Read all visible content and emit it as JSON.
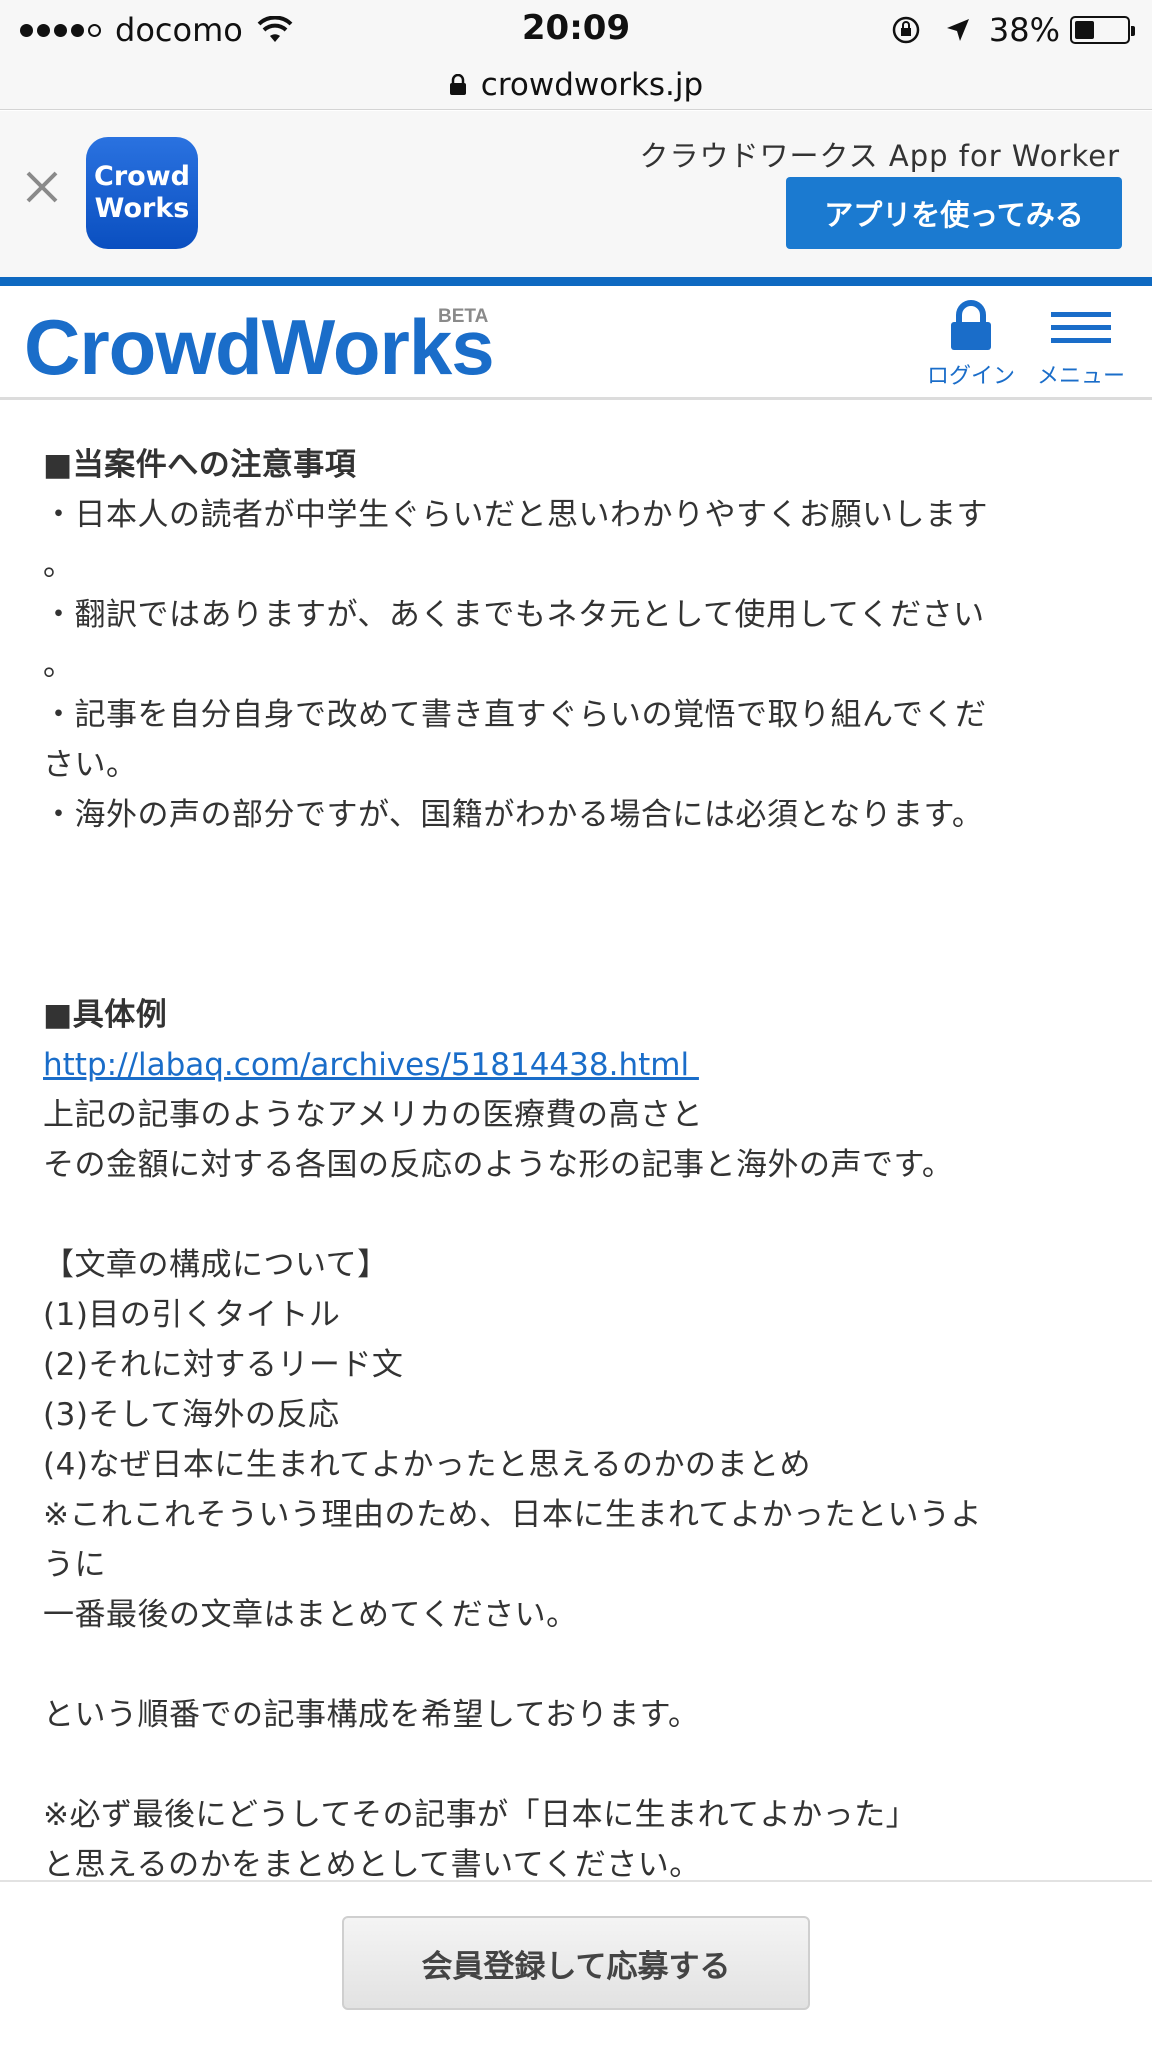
{
  "status_bar": {
    "carrier": "docomo",
    "time": "20:09",
    "battery_percent": "38%",
    "battery_level": 0.38
  },
  "browser": {
    "url": "crowdworks.jp"
  },
  "app_banner": {
    "title": "クラウドワークス App for Worker",
    "icon_line1": "Crowd",
    "icon_line2": "Works",
    "button_label": "アプリを使ってみる"
  },
  "header": {
    "logo": "CrowdWorks",
    "beta": "BETA",
    "login_label": "ログイン",
    "menu_label": "メニュー"
  },
  "content": {
    "lines": [
      {
        "text": "■当案件への注意事項",
        "style": "h"
      },
      {
        "text": "・日本人の読者が中学生ぐらいだと思いわかりやすくお願いします"
      },
      {
        "text": "。"
      },
      {
        "text": "・翻訳ではありますが、あくまでもネタ元として使用してください"
      },
      {
        "text": "。"
      },
      {
        "text": "・記事を自分自身で改めて書き直すぐらいの覚悟で取り組んでくだ"
      },
      {
        "text": "さい。"
      },
      {
        "text": "・海外の声の部分ですが、国籍がわかる場合には必須となります。"
      },
      {
        "text": ""
      },
      {
        "text": ""
      },
      {
        "text": ""
      },
      {
        "text": "■具体例",
        "style": "h"
      },
      {
        "text": "http://labaq.com/archives/51814438.html ",
        "style": "link"
      },
      {
        "text": "上記の記事のようなアメリカの医療費の高さと"
      },
      {
        "text": "その金額に対する各国の反応のような形の記事と海外の声です。"
      },
      {
        "text": ""
      },
      {
        "text": "【文章の構成について】"
      },
      {
        "text": "(1)目の引くタイトル"
      },
      {
        "text": "(2)それに対するリード文"
      },
      {
        "text": "(3)そして海外の反応"
      },
      {
        "text": "(4)なぜ日本に生まれてよかったと思えるのかのまとめ"
      },
      {
        "text": "※これこれそういう理由のため、日本に生まれてよかったというよ"
      },
      {
        "text": "うに"
      },
      {
        "text": "一番最後の文章はまとめてください。"
      },
      {
        "text": ""
      },
      {
        "text": "という順番での記事構成を希望しております。"
      },
      {
        "text": ""
      },
      {
        "text": "※必ず最後にどうしてその記事が「日本に生まれてよかった」"
      },
      {
        "text": "と思えるのかをまとめとして書いてください。"
      }
    ]
  },
  "footer": {
    "apply_label": "会員登録して応募する"
  }
}
